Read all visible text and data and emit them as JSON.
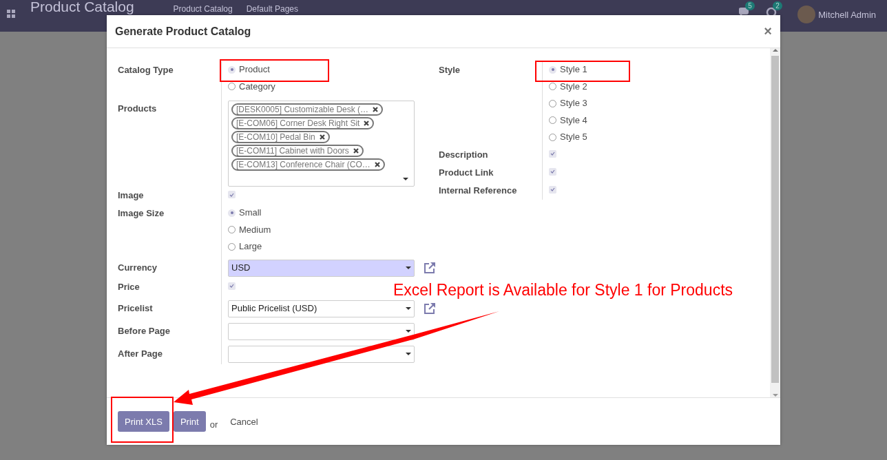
{
  "header": {
    "app_title": "Product Catalog",
    "menu": [
      "Product Catalog",
      "Default Pages"
    ],
    "badges": [
      {
        "count": "5",
        "kind": "chat"
      },
      {
        "count": "2",
        "kind": "activity"
      }
    ],
    "user": "Mitchell Admin"
  },
  "dialog": {
    "title": "Generate Product Catalog",
    "close": "×",
    "left_fields": [
      {
        "kind": "radio",
        "label": "Catalog Type",
        "options": [
          {
            "label": "Product",
            "selected": true
          },
          {
            "label": "Category",
            "selected": false
          }
        ]
      },
      {
        "kind": "tags",
        "label": "Products",
        "tags": [
          "[DESK0005] Customizable Desk (…",
          "[E-COM06] Corner Desk Right Sit",
          "[E-COM10] Pedal Bin",
          "[E-COM11] Cabinet with Doors",
          "[E-COM13] Conference Chair (CO…"
        ]
      },
      {
        "kind": "checkbox",
        "label": "Image",
        "checked": true
      },
      {
        "kind": "radio",
        "label": "Image Size",
        "options": [
          {
            "label": "Small",
            "selected": true
          },
          {
            "label": "Medium",
            "selected": false
          },
          {
            "label": "Large",
            "selected": false
          }
        ]
      },
      {
        "kind": "select",
        "label": "Currency",
        "value": "USD",
        "required": true,
        "external_link": true
      },
      {
        "kind": "checkbox",
        "label": "Price",
        "checked": true
      },
      {
        "kind": "select",
        "label": "Pricelist",
        "value": "Public Pricelist (USD)",
        "required": false,
        "external_link": true
      },
      {
        "kind": "select",
        "label": "Before Page",
        "required": false,
        "external_link": false
      },
      {
        "kind": "select",
        "label": "After Page",
        "required": false,
        "external_link": false
      }
    ],
    "right_fields": [
      {
        "kind": "radio",
        "label": "Style",
        "options": [
          {
            "label": "Style 1",
            "selected": true
          },
          {
            "label": "Style 2",
            "selected": false
          },
          {
            "label": "Style 3",
            "selected": false
          },
          {
            "label": "Style 4",
            "selected": false
          },
          {
            "label": "Style 5",
            "selected": false
          }
        ]
      },
      {
        "kind": "checkbox",
        "label": "Description",
        "checked": true
      },
      {
        "kind": "checkbox",
        "label": "Product Link",
        "checked": true
      },
      {
        "kind": "checkbox",
        "label": "Internal Reference",
        "checked": true
      }
    ],
    "buttons": [
      {
        "label": "Print XLS",
        "kind": "primary"
      },
      {
        "label": "Print",
        "kind": "primary"
      },
      {
        "label": "or",
        "kind": "text"
      },
      {
        "label": "Cancel",
        "kind": "link"
      }
    ]
  },
  "annotation": {
    "text": "Excel Report is Available for Style 1 for Products"
  }
}
